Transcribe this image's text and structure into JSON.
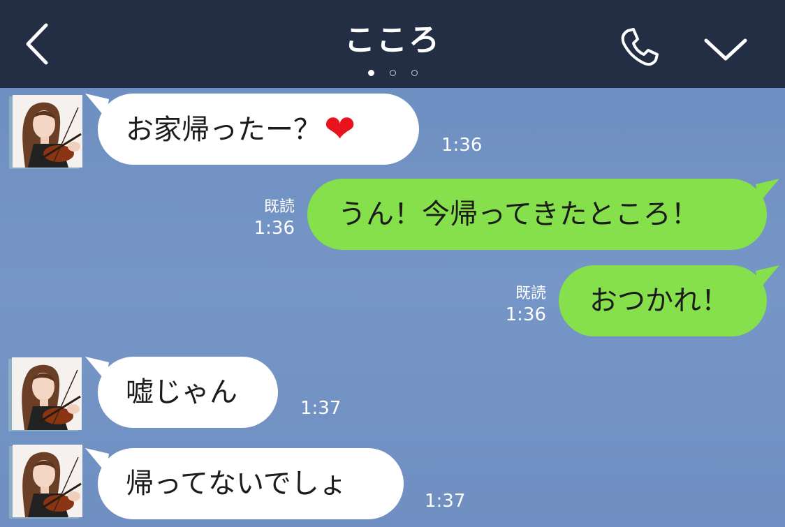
{
  "header": {
    "title": "こころ",
    "page_dots": 3,
    "active_dot": 0
  },
  "colors": {
    "header_bg": "#232e44",
    "chat_bg": "#7090c2",
    "incoming_bubble": "#ffffff",
    "outgoing_bubble": "#86e04b",
    "heart": "#e8141d"
  },
  "icons": {
    "back": "chevron-left-icon",
    "call": "phone-icon",
    "menu": "chevron-down-icon",
    "heart": "heart-icon"
  },
  "messages": [
    {
      "direction": "incoming",
      "text": "お家帰ったー？",
      "emoji": "❤",
      "time": "1:36"
    },
    {
      "direction": "outgoing",
      "text": "うん！今帰ってきたところ！",
      "read": "既読",
      "time": "1:36"
    },
    {
      "direction": "outgoing",
      "text": "おつかれ！",
      "read": "既読",
      "time": "1:36"
    },
    {
      "direction": "incoming",
      "text": "嘘じゃん",
      "time": "1:37"
    },
    {
      "direction": "incoming",
      "text": "帰ってないでしょ",
      "time": "1:37"
    }
  ]
}
